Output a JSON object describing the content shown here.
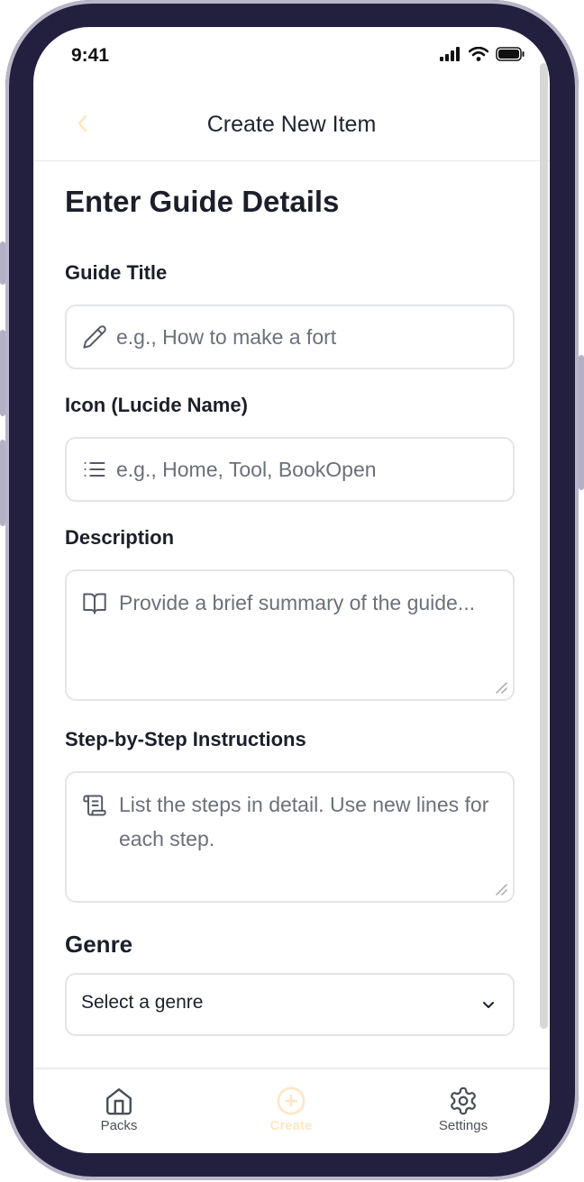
{
  "status_bar": {
    "time": "9:41"
  },
  "header": {
    "title": "Create New Item",
    "back_icon": "chevron-left-icon"
  },
  "form": {
    "section_title": "Enter Guide Details",
    "guide_title": {
      "label": "Guide Title",
      "placeholder": "e.g., How to make a fort",
      "icon": "pencil-icon"
    },
    "icon_name": {
      "label": "Icon (Lucide Name)",
      "placeholder": "e.g., Home, Tool, BookOpen",
      "icon": "list-icon"
    },
    "description": {
      "label": "Description",
      "placeholder": "Provide a brief summary of the guide...",
      "icon": "book-open-icon"
    },
    "instructions": {
      "label": "Step-by-Step Instructions",
      "placeholder": "List the steps in detail. Use new lines for each step.",
      "icon": "scroll-text-icon"
    },
    "genre": {
      "label": "Genre",
      "selected": "Select a genre",
      "icon": "chevron-down-icon"
    }
  },
  "tabs": [
    {
      "label": "Packs",
      "icon": "home-icon"
    },
    {
      "label": "Create",
      "icon": "plus-circle-icon",
      "active": true
    },
    {
      "label": "Settings",
      "icon": "gear-icon"
    }
  ],
  "colors": {
    "frame": "#23203f",
    "accent": "#fde7c2",
    "border": "#e3e5e8",
    "text": "#1c1f2a",
    "placeholder": "#6b7079"
  }
}
